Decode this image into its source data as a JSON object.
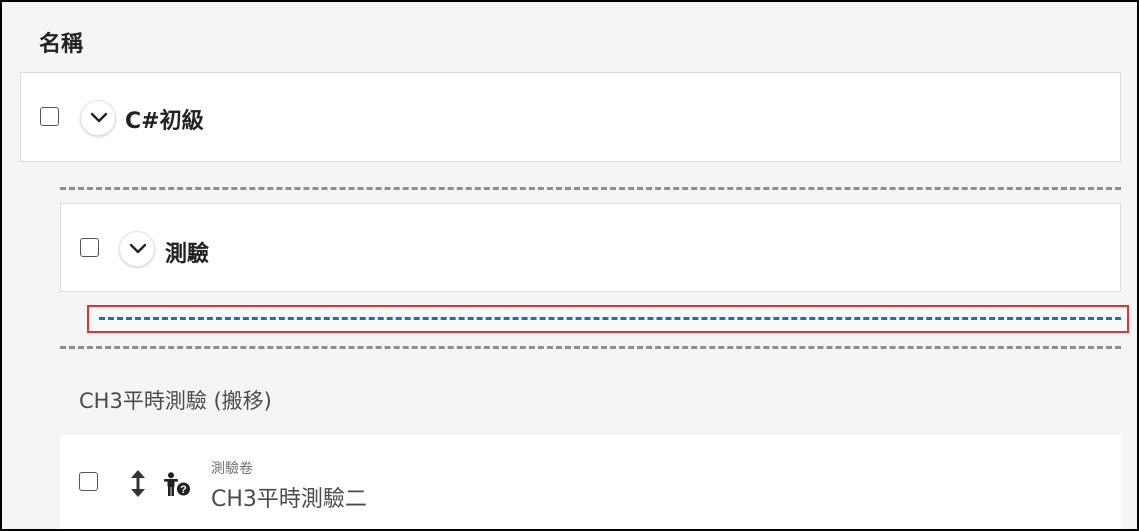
{
  "header": {
    "column_name": "名稱"
  },
  "course": {
    "title": "C#初級"
  },
  "module": {
    "title": "測驗"
  },
  "unit": {
    "title": "CH3平時測驗 (搬移)"
  },
  "topic": {
    "type": "測驗卷",
    "name": "CH3平時測驗二"
  },
  "icons": {
    "expand": "chevron-down-icon",
    "move": "move-vertical-icon",
    "restrictions": "person-question-icon"
  },
  "colors": {
    "drop_target_border": "#d93636",
    "drop_indicator": "#1e6fb7",
    "separator": "#8e8e8e"
  }
}
